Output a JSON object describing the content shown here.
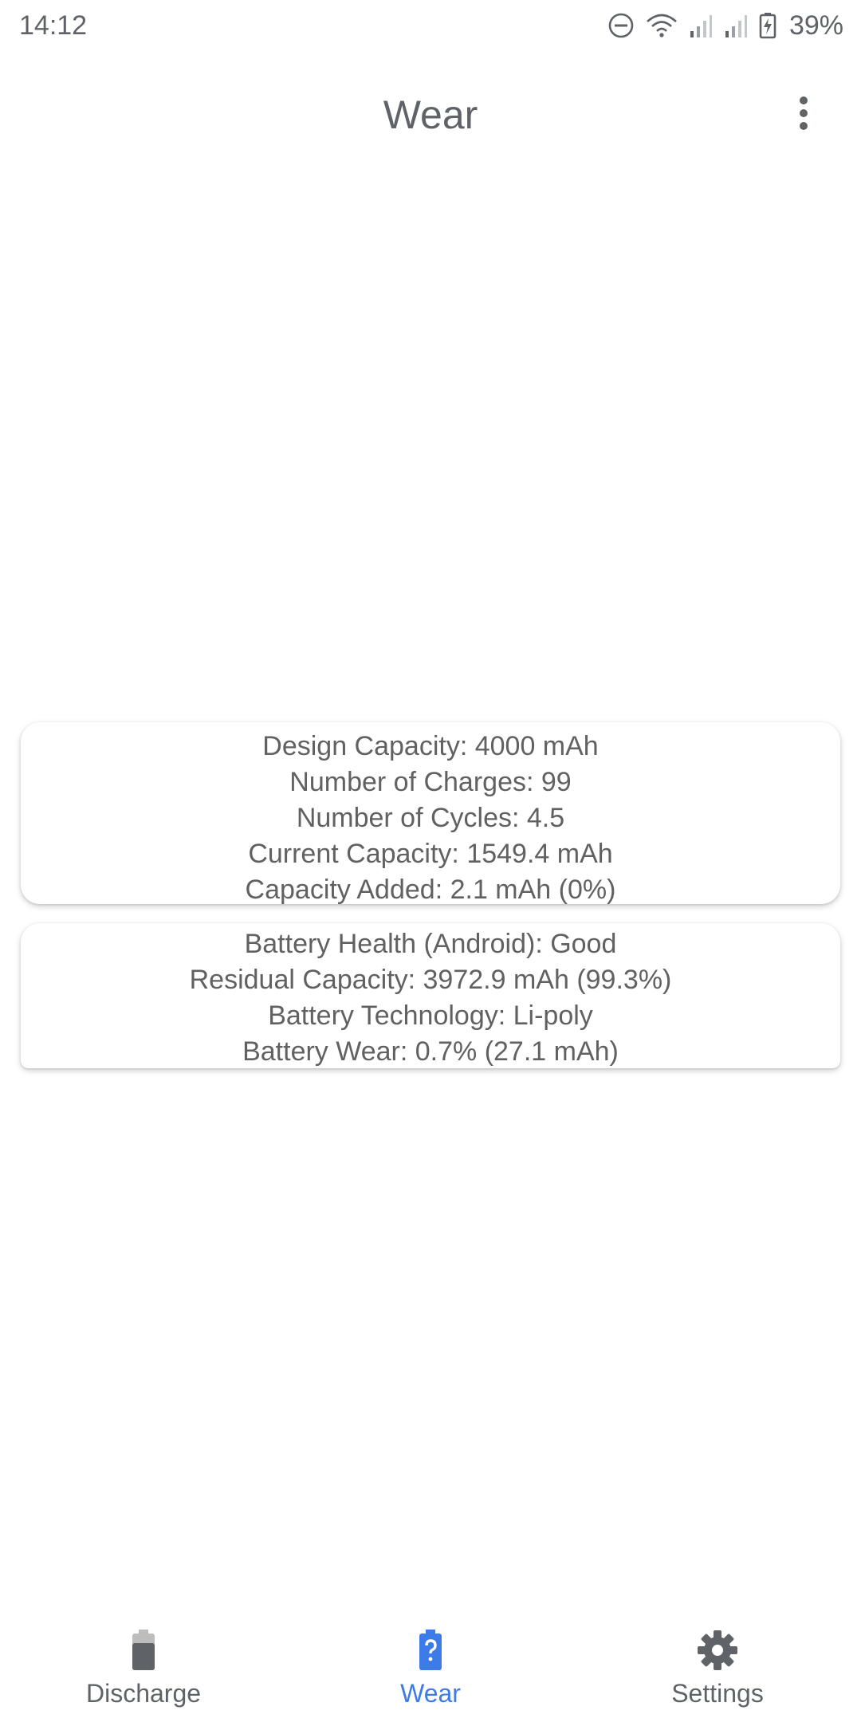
{
  "status_bar": {
    "time": "14:12",
    "battery_percent": "39%",
    "icons": [
      "do-not-disturb-icon",
      "wifi-icon",
      "signal-icon",
      "signal-icon",
      "battery-charging-icon"
    ]
  },
  "app_bar": {
    "title": "Wear",
    "overflow_icon": "more-vert-icon"
  },
  "card_capacity": {
    "lines": [
      "Design Capacity: 4000 mAh",
      "Number of Charges: 99",
      "Number of Cycles: 4.5",
      "Current Capacity: 1549.4 mAh",
      "Capacity Added: 2.1 mAh (0%)"
    ]
  },
  "card_health": {
    "lines": [
      "Battery Health (Android): Good",
      "Residual Capacity: 3972.9 mAh (99.3%)",
      "Battery Technology: Li-poly",
      "Battery Wear: 0.7% (27.1 mAh)"
    ]
  },
  "bottom_nav": {
    "items": [
      {
        "label": "Discharge",
        "icon": "battery-icon",
        "active": false
      },
      {
        "label": "Wear",
        "icon": "battery-unknown-icon",
        "active": true
      },
      {
        "label": "Settings",
        "icon": "gear-icon",
        "active": false
      }
    ]
  },
  "colors": {
    "text": "#5f6368",
    "accent": "#3d7be8",
    "background": "#ffffff"
  }
}
